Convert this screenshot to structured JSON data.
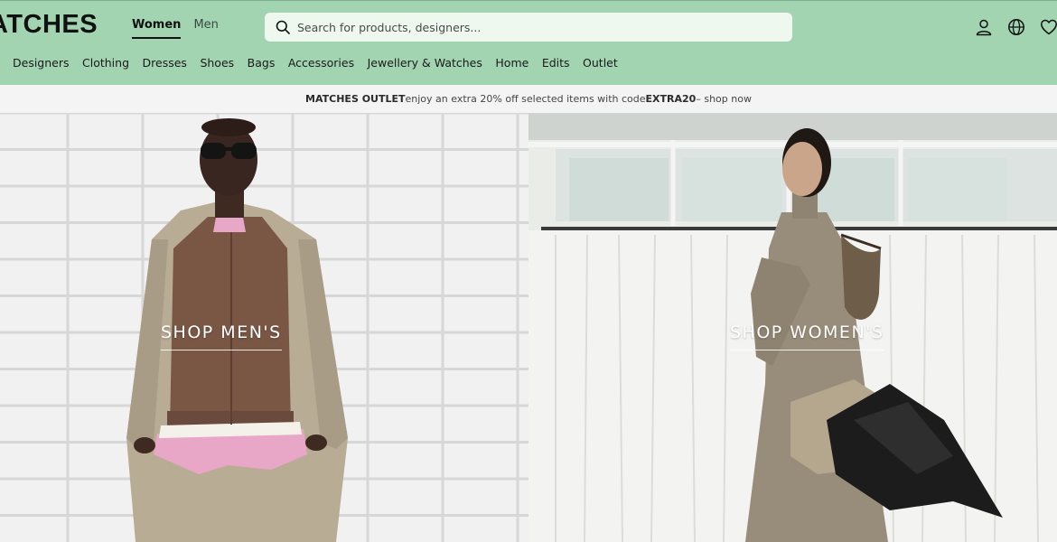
{
  "brand": {
    "logo_text": "ATCHES"
  },
  "gender_tabs": [
    {
      "label": "Women",
      "active": true
    },
    {
      "label": "Men",
      "active": false
    }
  ],
  "search": {
    "placeholder": "Search for products, designers..."
  },
  "utility_icons": [
    "account-icon",
    "globe-icon",
    "heart-icon"
  ],
  "nav": {
    "items": [
      "Designers",
      "Clothing",
      "Dresses",
      "Shoes",
      "Bags",
      "Accessories",
      "Jewellery & Watches",
      "Home",
      "Edits",
      "Outlet"
    ]
  },
  "promo": {
    "brand": "MATCHES OUTLET",
    "text": " enjoy an extra 20% off selected items with code ",
    "code": "EXTRA20",
    "link": " – shop now"
  },
  "hero": {
    "men_cta": "SHOP MEN'S",
    "women_cta": "SHOP WOMEN'S"
  },
  "colors": {
    "header_bg": "#a2d4b2",
    "search_bg": "#eef8ee",
    "promo_bg": "#f4f4f4"
  }
}
